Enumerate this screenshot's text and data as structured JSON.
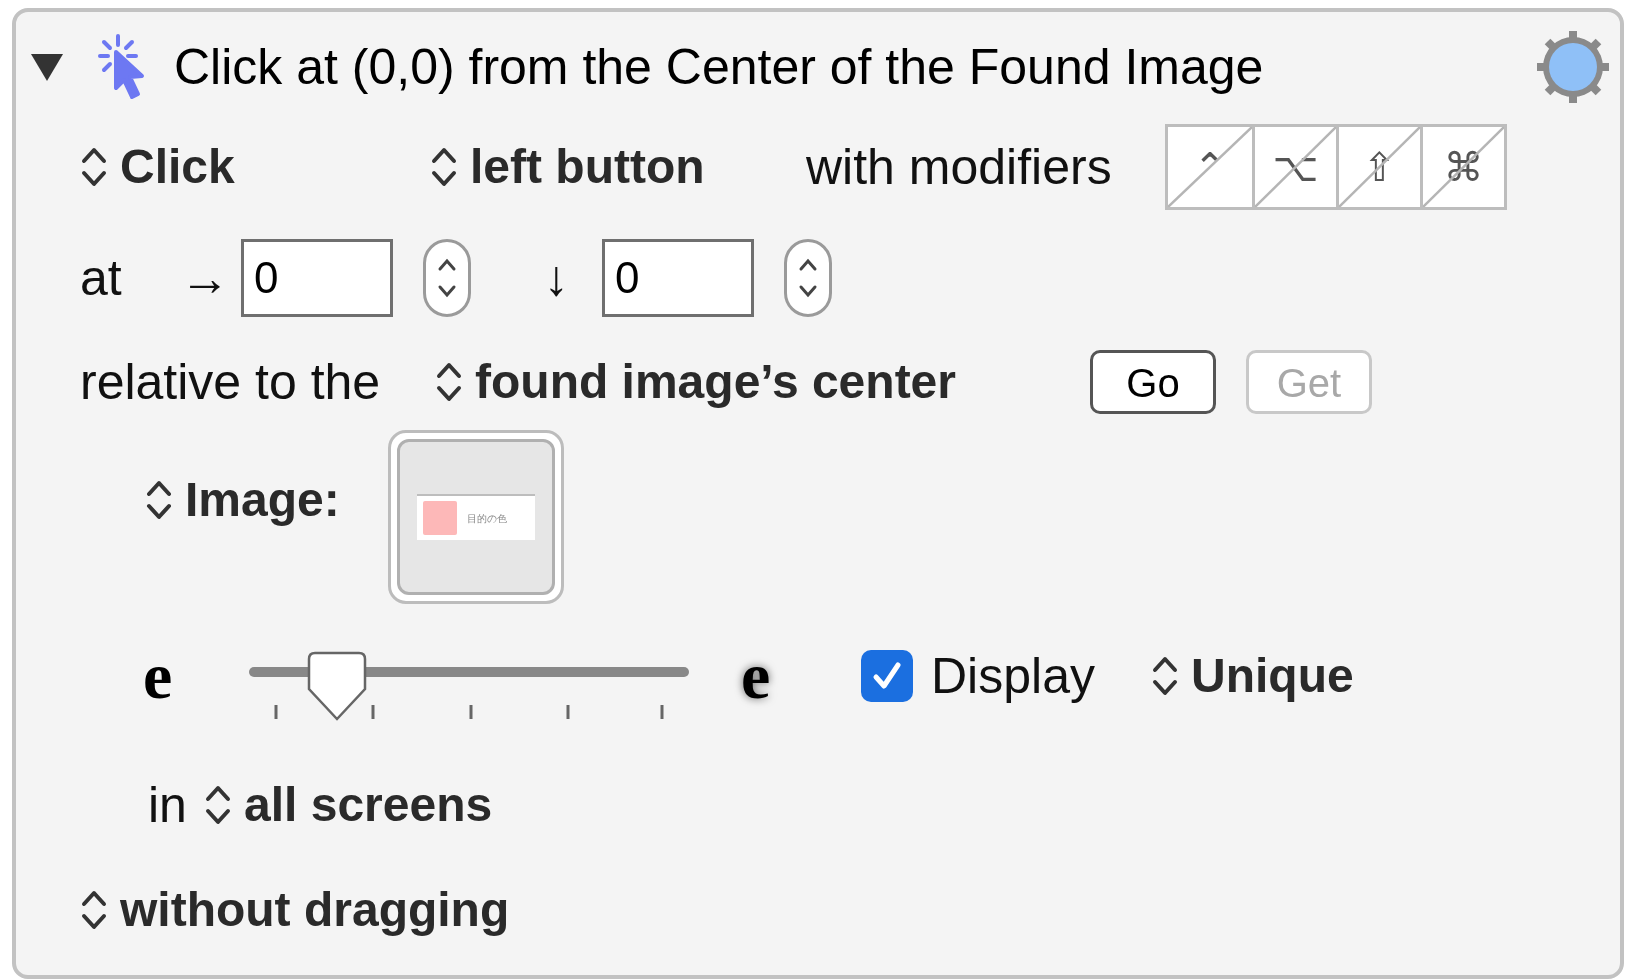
{
  "action": {
    "expanded": true,
    "title": "Click at (0,0) from the Center of the Found Image"
  },
  "click_row": {
    "action_popup": "Click",
    "button_popup": "left button",
    "modifiers_label": "with modifiers",
    "modifiers": [
      {
        "symbol": "⌃",
        "selected": false
      },
      {
        "symbol": "⌥",
        "selected": false
      },
      {
        "symbol": "⇧",
        "selected": false
      },
      {
        "symbol": "⌘",
        "selected": false
      }
    ]
  },
  "position_row": {
    "label": "at",
    "x_arrow": "→",
    "x_value": "0",
    "y_arrow": "↓",
    "y_value": "0"
  },
  "relative_row": {
    "label": "relative to the",
    "anchor_popup": "found image’s center",
    "buttons": [
      {
        "label": "Go",
        "disabled": false
      },
      {
        "label": "Get",
        "disabled": true
      }
    ]
  },
  "image_row": {
    "source_popup": "Image:",
    "thumbnail_text": "目的の色"
  },
  "fuzz_row": {
    "low_label": "e",
    "level": 0.2,
    "high_label": "e",
    "display": {
      "label": "Display",
      "checked": true
    },
    "match_popup": "Unique"
  },
  "screens_row": {
    "label": "in",
    "screens_popup": "all screens"
  },
  "drag_popup": "without dragging"
}
